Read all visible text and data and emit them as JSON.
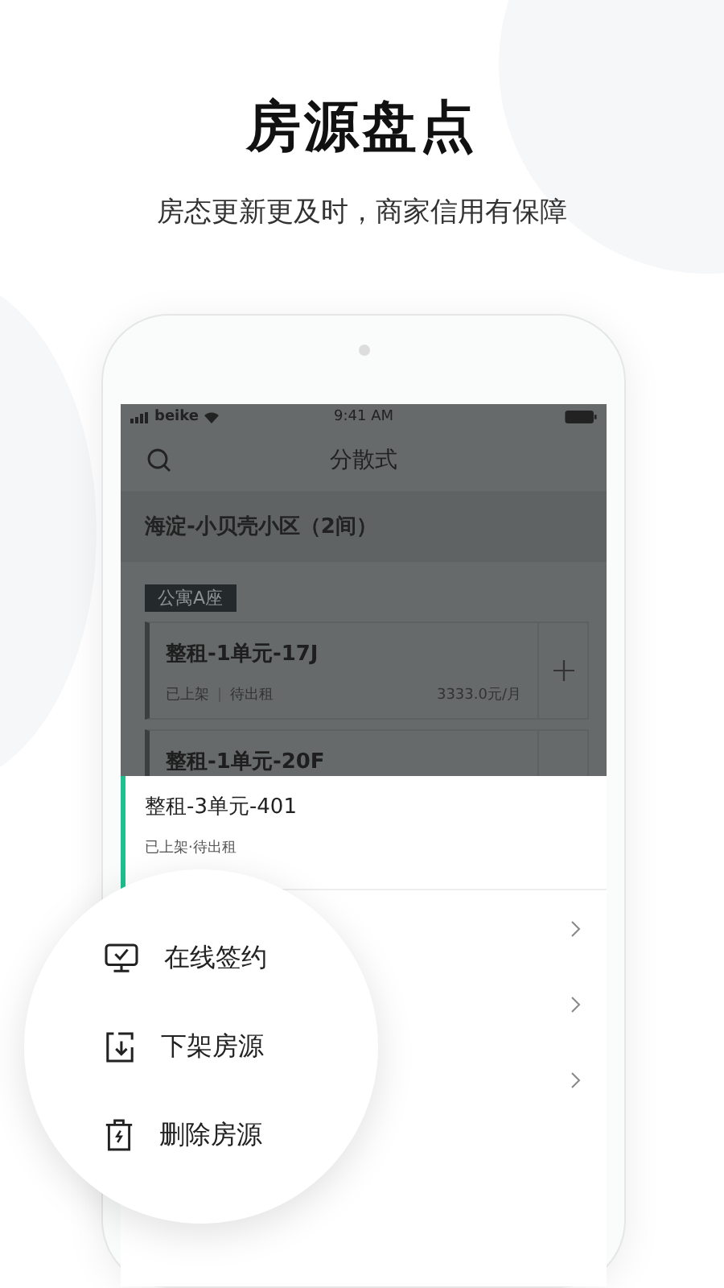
{
  "headline": "房源盘点",
  "tagline": "房态更新更及时，商家信用有保障",
  "status_bar": {
    "carrier": "beike",
    "time": "9:41 AM"
  },
  "nav": {
    "title": "分散式"
  },
  "community": {
    "title": "海淀-小贝壳小区（2间）"
  },
  "building_tag": "公寓A座",
  "listings": [
    {
      "title": "整租-1单元-17J",
      "status": "已上架",
      "rent_status": "待出租",
      "price": "3333.0元/月"
    },
    {
      "title": "整租-1单元-20F"
    }
  ],
  "selected_listing": {
    "title": "整租-3单元-401",
    "status": "已上架·待出租"
  },
  "actions": [
    {
      "kind": "sign",
      "label": "在线签约"
    },
    {
      "kind": "unlist",
      "label": "下架房源"
    },
    {
      "kind": "delete",
      "label": "删除房源"
    }
  ]
}
